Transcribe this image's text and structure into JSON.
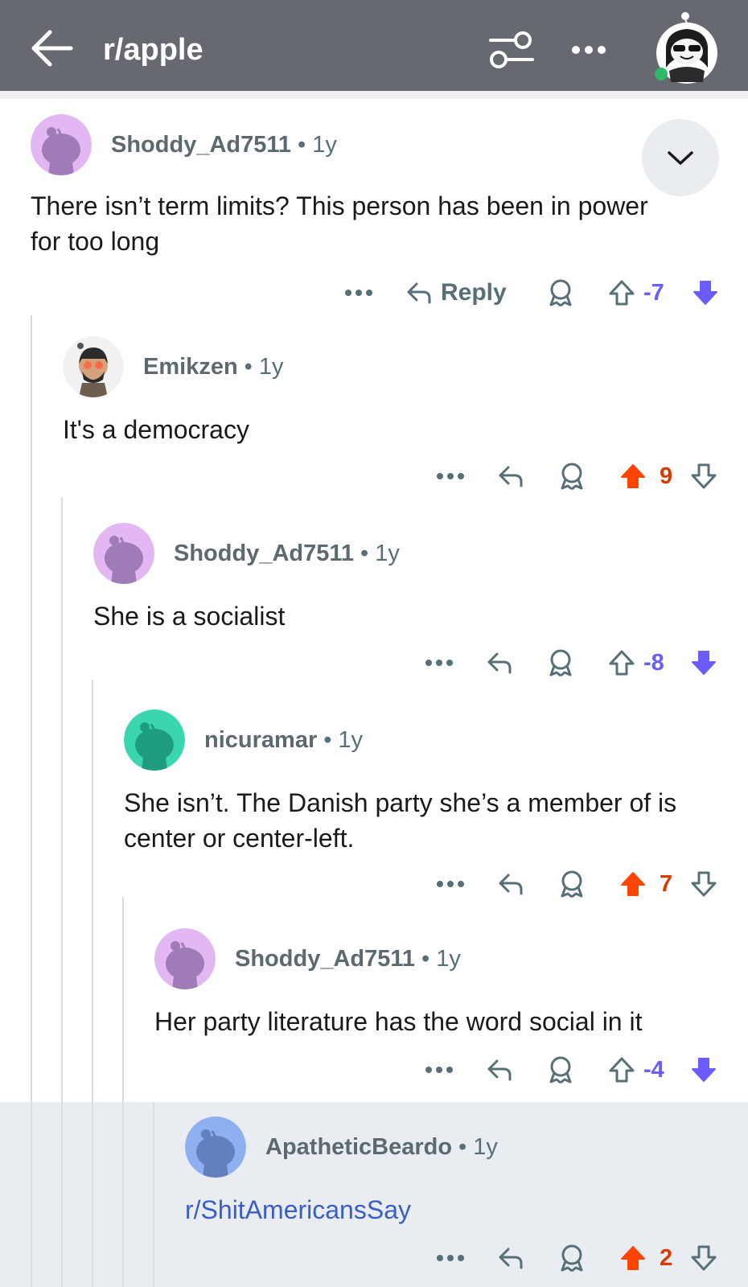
{
  "header": {
    "title": "r/apple",
    "back_icon": "arrow-left-icon",
    "filter_icon": "sort-filter-icon",
    "more_icon": "more-horizontal-icon",
    "avatar_icon": "user-avatar-icon"
  },
  "colors": {
    "header_bg": "#66696f",
    "upvote_active": "#ff4500",
    "downvote_active": "#6a5cff",
    "meta_text": "#576f76",
    "link": "#3a5fc4",
    "highlight_bg": "#e9edf1"
  },
  "comments": [
    {
      "author": "Shoddy_Ad7511",
      "age": "1y",
      "text": "There isn’t term limits? This person has been in power for too long",
      "reply_label": "Reply",
      "score": "-7",
      "vote": "down"
    },
    {
      "author": "Emikzen",
      "age": "1y",
      "text": "It's a democracy",
      "score": "9",
      "vote": "up"
    },
    {
      "author": "Shoddy_Ad7511",
      "age": "1y",
      "text": "She is a socialist",
      "score": "-8",
      "vote": "down"
    },
    {
      "author": "nicuramar",
      "age": "1y",
      "text": "She isn’t. The Danish party she’s a member of is center or center-left.",
      "score": "7",
      "vote": "up"
    },
    {
      "author": "Shoddy_Ad7511",
      "age": "1y",
      "text": "Her party literature has the word social in it",
      "score": "-4",
      "vote": "down"
    },
    {
      "author": "ApatheticBeardo",
      "age": "1y",
      "text": "r/ShitAmericansSay",
      "score": "2",
      "vote": "up"
    }
  ],
  "separator": "•"
}
